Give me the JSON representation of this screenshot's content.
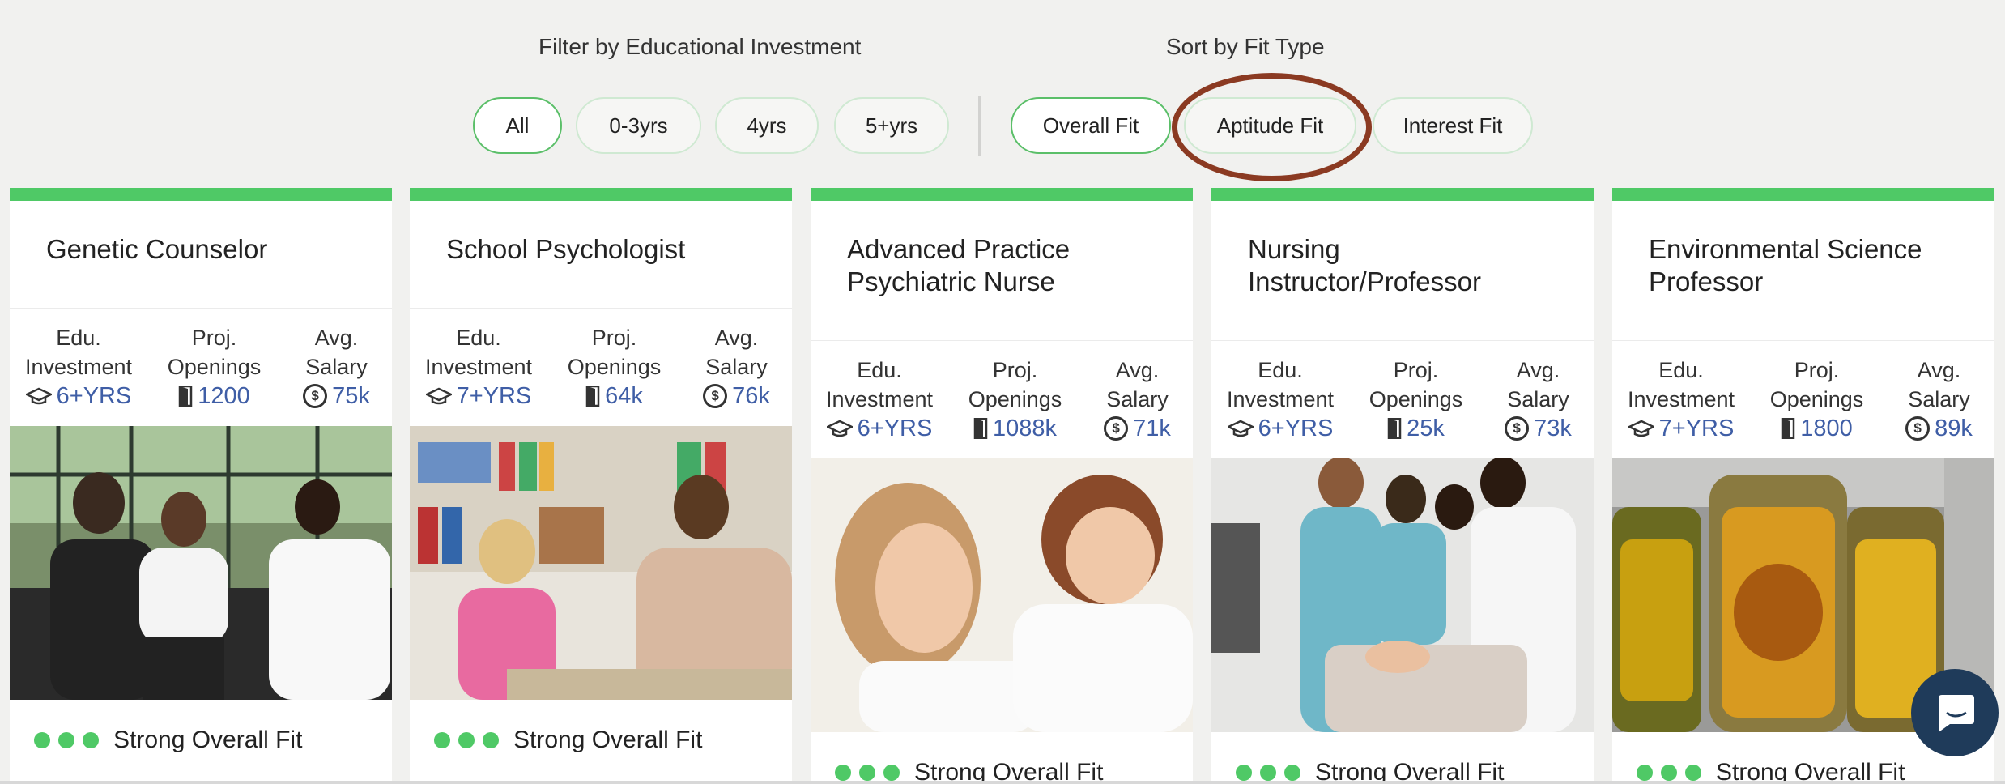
{
  "filters": {
    "edu_label": "Filter by Educational Investment",
    "sort_label": "Sort by Fit Type",
    "edu_options": [
      "All",
      "0-3yrs",
      "4yrs",
      "5+yrs"
    ],
    "fit_options": [
      "Overall Fit",
      "Aptitude Fit",
      "Interest Fit"
    ],
    "active_edu": "All",
    "active_fit": "Overall Fit",
    "circled": "Aptitude Fit"
  },
  "stat_labels": {
    "edu_line1": "Edu.",
    "edu_line2": "Investment",
    "proj_line1": "Proj.",
    "proj_line2": "Openings",
    "sal_line1": "Avg.",
    "sal_line2": "Salary"
  },
  "cards": [
    {
      "title": "Genetic Counselor",
      "edu": "6+YRS",
      "openings": "1200",
      "salary": "75k",
      "fit": "Strong Overall Fit",
      "photo": "three-people-meeting-with-doctor"
    },
    {
      "title": "School Psychologist",
      "edu": "7+YRS",
      "openings": "64k",
      "salary": "76k",
      "fit": "Strong Overall Fit",
      "photo": "woman-with-child-at-desk"
    },
    {
      "title": "Advanced Practice Psychiatric Nurse",
      "edu": "6+YRS",
      "openings": "1088k",
      "salary": "71k",
      "fit": "Strong Overall Fit",
      "photo": "nurse-with-girl"
    },
    {
      "title": "Nursing Instructor/Professor",
      "edu": "6+YRS",
      "openings": "25k",
      "salary": "73k",
      "fit": "Strong Overall Fit",
      "photo": "nurses-training-on-mannequin"
    },
    {
      "title": "Environmental Science Professor",
      "edu": "7+YRS",
      "openings": "1800",
      "salary": "89k",
      "fit": "Strong Overall Fit",
      "photo": "specimen-jars"
    }
  ],
  "colors": {
    "accent_green": "#4fc966",
    "value_blue": "#3f5ea6",
    "highlight_circle": "#8b3a22",
    "chat_button": "#1f3b5a"
  },
  "icons": {
    "edu": "graduation-cap-icon",
    "openings": "door-icon",
    "salary": "dollar-coin-icon",
    "chat": "chat-bubble-icon"
  }
}
